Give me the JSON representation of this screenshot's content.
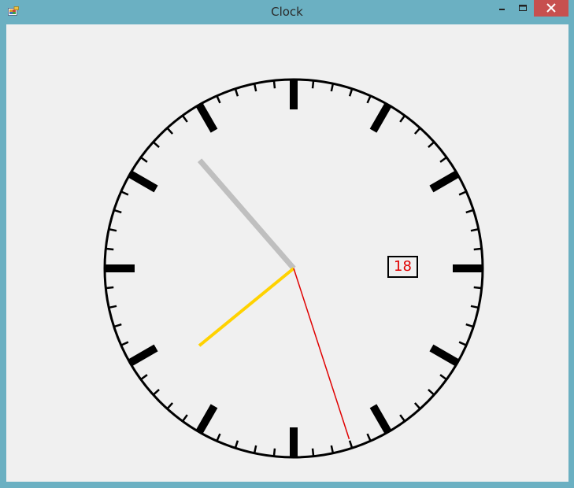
{
  "window": {
    "title": "Clock",
    "icon": "app-icon",
    "controls": {
      "minimize_icon": "minimize-icon",
      "maximize_icon": "maximize-icon",
      "close_icon": "close-icon"
    }
  },
  "clock": {
    "time": {
      "hour": 10,
      "minute": 38,
      "second": 27
    },
    "date_day": "18",
    "colors": {
      "face": "#f0f0f0",
      "rim": "#000000",
      "hour_hand": "#bfbfbf",
      "minute_hand": "#ffd200",
      "second_hand": "#e00000",
      "date_text": "#e00000"
    }
  }
}
